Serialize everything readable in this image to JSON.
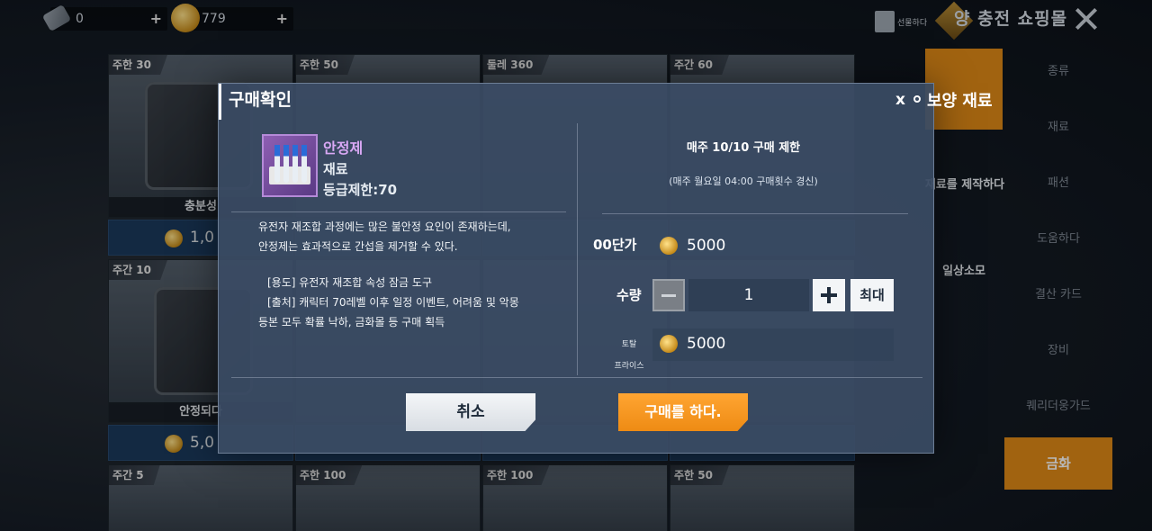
{
  "resources": [
    {
      "icon": "ticket-icon",
      "value": "0"
    },
    {
      "icon": "gold-coin-icon",
      "value": "779"
    }
  ],
  "header": {
    "gift_label": "선물하다",
    "title": "양 충전 쇼핑몰"
  },
  "shop_cards": [
    {
      "limit": "주한 30",
      "name": "충분성",
      "price": "1,0"
    },
    {
      "limit": "주한 50",
      "name": "",
      "price": ""
    },
    {
      "limit": "둘레 360",
      "name": "",
      "price": ""
    },
    {
      "limit": "주간 60",
      "name": "",
      "price": ""
    },
    {
      "limit": "주간 10",
      "name": "안정되다",
      "price": "5,0"
    },
    {
      "limit": "주간 5",
      "name": "",
      "price": ""
    },
    {
      "limit": "주한 100",
      "name": "",
      "price": ""
    },
    {
      "limit": "주한 100",
      "name": "",
      "price": ""
    },
    {
      "limit": "주한 50",
      "name": "",
      "price": ""
    }
  ],
  "side_tabs": [
    {
      "label": "보양 재료",
      "active": false
    },
    {
      "label": "재료를 제작하다",
      "active": false
    },
    {
      "label": "일상소모",
      "active": false
    }
  ],
  "right_tabs": [
    {
      "label": "종류"
    },
    {
      "label": "재료"
    },
    {
      "label": "패션"
    },
    {
      "label": "도움하다"
    },
    {
      "label": "결산 카드"
    },
    {
      "label": "장비"
    },
    {
      "label": "퀘리더웅가드"
    },
    {
      "label": "금화",
      "active": true
    }
  ],
  "dialog": {
    "title": "구매확인",
    "close": "x",
    "item": {
      "name": "안정제",
      "type": "재료",
      "grade": "등급제한:70"
    },
    "description": [
      "유전자 재조합 과정에는 많은 불안정 요인이 존재하는데,",
      "안정제는 효과적으로 간섭을 제거할 수 있다.",
      "",
      "[용도] 유전자 재조합 속성 잠금 도구",
      "[출처] 캐릭터 70레벨 이후 일정 이벤트, 어려움 및 악몽",
      "등본 모두 확률 낙하, 금화몰 등 구매 획득"
    ],
    "limit_text": "매주 10/10 구매 제한",
    "renew_text": "(매주 월요일 04:00 구매횟수 경신)",
    "unit_price_label": "00단가",
    "unit_price": "5000",
    "quantity_label": "수량",
    "quantity": "1",
    "max_label": "최대",
    "total_label_1": "토탈",
    "total_label_2": "프라이스",
    "total_price": "5000",
    "cancel_label": "취소",
    "buy_label": "구매를 하다."
  },
  "colors": {
    "accent": "#ee8b14",
    "item_name": "#d9a8f5",
    "price_bar": "#1b3a5c"
  }
}
